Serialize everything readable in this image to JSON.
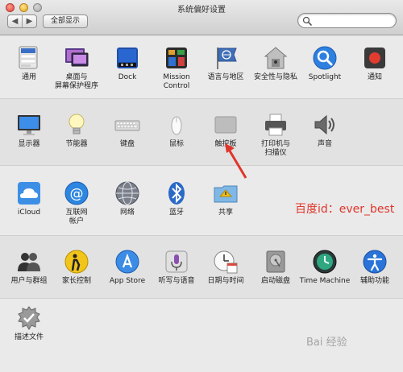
{
  "window": {
    "title": "系统偏好设置"
  },
  "toolbar": {
    "show_all_label": "全部显示",
    "back_glyph": "◀",
    "forward_glyph": "▶"
  },
  "search": {
    "value": "",
    "placeholder": ""
  },
  "sections": [
    {
      "items": [
        {
          "label": "通用",
          "icon": "general-icon"
        },
        {
          "label": "桌面与\n屏幕保护程序",
          "icon": "desktop-screensaver-icon"
        },
        {
          "label": "Dock",
          "icon": "dock-icon"
        },
        {
          "label": "Mission\nControl",
          "icon": "mission-control-icon"
        },
        {
          "label": "语言与地区",
          "icon": "language-region-icon"
        },
        {
          "label": "安全性与隐私",
          "icon": "security-privacy-icon"
        },
        {
          "label": "Spotlight",
          "icon": "spotlight-icon"
        },
        {
          "label": "通知",
          "icon": "notifications-icon"
        }
      ]
    },
    {
      "items": [
        {
          "label": "显示器",
          "icon": "displays-icon"
        },
        {
          "label": "节能器",
          "icon": "energy-saver-icon"
        },
        {
          "label": "键盘",
          "icon": "keyboard-icon"
        },
        {
          "label": "鼠标",
          "icon": "mouse-icon"
        },
        {
          "label": "触控板",
          "icon": "trackpad-icon"
        },
        {
          "label": "打印机与\n扫描仪",
          "icon": "printer-scanner-icon"
        },
        {
          "label": "声音",
          "icon": "sound-icon"
        }
      ]
    },
    {
      "items": [
        {
          "label": "iCloud",
          "icon": "icloud-icon"
        },
        {
          "label": "互联网\n帐户",
          "icon": "internet-accounts-icon"
        },
        {
          "label": "网络",
          "icon": "network-icon"
        },
        {
          "label": "蓝牙",
          "icon": "bluetooth-icon"
        },
        {
          "label": "共享",
          "icon": "sharing-icon"
        }
      ]
    },
    {
      "items": [
        {
          "label": "用户与群组",
          "icon": "users-groups-icon"
        },
        {
          "label": "家长控制",
          "icon": "parental-controls-icon"
        },
        {
          "label": "App Store",
          "icon": "app-store-icon"
        },
        {
          "label": "听写与语音",
          "icon": "dictation-speech-icon"
        },
        {
          "label": "日期与时间",
          "icon": "date-time-icon"
        },
        {
          "label": "启动磁盘",
          "icon": "startup-disk-icon"
        },
        {
          "label": "Time Machine",
          "icon": "time-machine-icon"
        },
        {
          "label": "辅助功能",
          "icon": "accessibility-icon"
        }
      ]
    },
    {
      "items": [
        {
          "label": "描述文件",
          "icon": "profiles-icon"
        }
      ]
    }
  ],
  "annotation": {
    "text": "百度id：ever_best",
    "color": "#e0362b"
  },
  "watermark": {
    "text": "Bai 经验"
  }
}
